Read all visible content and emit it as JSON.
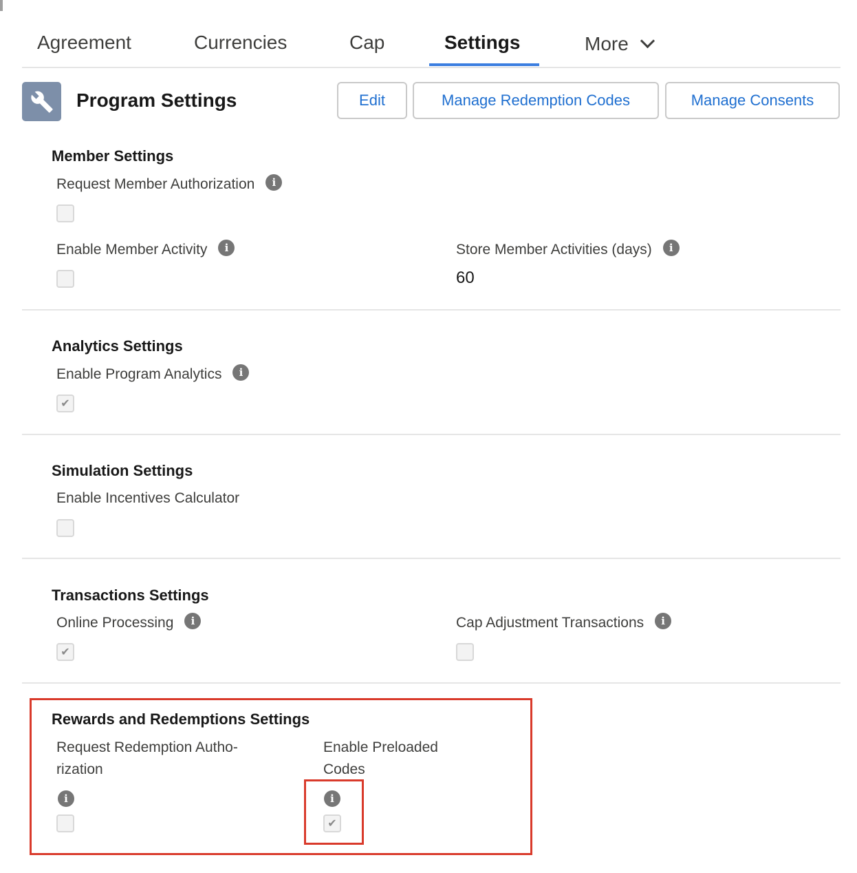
{
  "tabs": [
    {
      "label": "Agreement"
    },
    {
      "label": "Currencies"
    },
    {
      "label": "Cap"
    },
    {
      "label": "Settings"
    },
    {
      "label": "More"
    }
  ],
  "header": {
    "title": "Program Settings",
    "icon": "wrench-icon",
    "buttons": {
      "edit": "Edit",
      "manage_redemption_codes": "Manage Redemption Codes",
      "manage_consents": "Manage Consents"
    }
  },
  "sections": {
    "member": {
      "title": "Member Settings",
      "request_member_authorization": {
        "label": "Request Member Authorization",
        "checked": false
      },
      "enable_member_activity": {
        "label": "Enable Member Activity",
        "checked": false
      },
      "store_member_activities": {
        "label": "Store Member Activities (days)",
        "value": "60"
      }
    },
    "analytics": {
      "title": "Analytics Settings",
      "enable_program_analytics": {
        "label": "Enable Program Analytics",
        "checked": true
      }
    },
    "simulation": {
      "title": "Simulation Settings",
      "enable_incentives_calculator": {
        "label": "Enable Incentives Calculator",
        "checked": false
      }
    },
    "transactions": {
      "title": "Transactions Settings",
      "online_processing": {
        "label": "Online Processing",
        "checked": true
      },
      "cap_adjustment_transactions": {
        "label": "Cap Adjustment Transactions",
        "checked": false
      }
    },
    "rewards": {
      "title": "Rewards and Redemptions Settings",
      "request_redemption_authorization": {
        "label_line1": "Request Redemption Autho-",
        "label_line2": "rization",
        "checked": false
      },
      "enable_preloaded_codes": {
        "label_line1": "Enable Preloaded",
        "label_line2": "Codes",
        "checked": true
      }
    }
  },
  "colors": {
    "accent": "#3c7ee0",
    "link": "#1f6fd0",
    "highlight": "#d93a2b",
    "icon_bg": "#7d8fa9"
  }
}
